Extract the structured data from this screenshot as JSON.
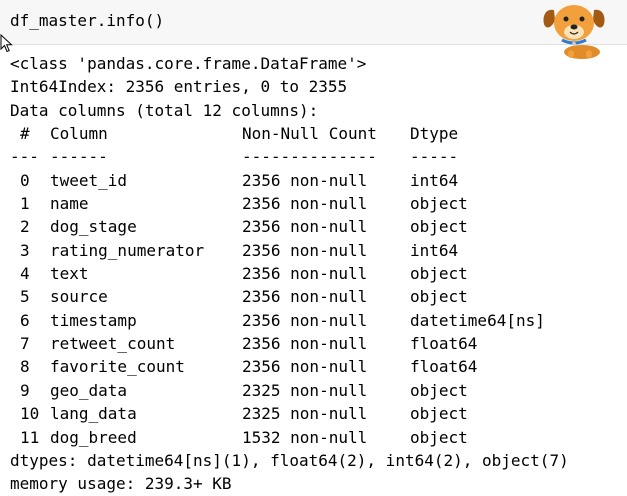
{
  "cell": {
    "code": "df_master.info()"
  },
  "output": {
    "class_line": "<class 'pandas.core.frame.DataFrame'>",
    "index_line": "Int64Index: 2356 entries, 0 to 2355",
    "columns_line": "Data columns (total 12 columns):",
    "header": {
      "idx": "#",
      "column": "Column",
      "count": "Non-Null Count",
      "dtype": "Dtype"
    },
    "separator": {
      "idx": "---",
      "column": "------",
      "count": "--------------",
      "dtype": "-----"
    },
    "rows": [
      {
        "idx": "0",
        "column": "tweet_id",
        "count": "2356 non-null",
        "dtype": "int64"
      },
      {
        "idx": "1",
        "column": "name",
        "count": "2356 non-null",
        "dtype": "object"
      },
      {
        "idx": "2",
        "column": "dog_stage",
        "count": "2356 non-null",
        "dtype": "object"
      },
      {
        "idx": "3",
        "column": "rating_numerator",
        "count": "2356 non-null",
        "dtype": "int64"
      },
      {
        "idx": "4",
        "column": "text",
        "count": "2356 non-null",
        "dtype": "object"
      },
      {
        "idx": "5",
        "column": "source",
        "count": "2356 non-null",
        "dtype": "object"
      },
      {
        "idx": "6",
        "column": "timestamp",
        "count": "2356 non-null",
        "dtype": "datetime64[ns]"
      },
      {
        "idx": "7",
        "column": "retweet_count",
        "count": "2356 non-null",
        "dtype": "float64"
      },
      {
        "idx": "8",
        "column": "favorite_count",
        "count": "2356 non-null",
        "dtype": "float64"
      },
      {
        "idx": "9",
        "column": "geo_data",
        "count": "2325 non-null",
        "dtype": "object"
      },
      {
        "idx": "10",
        "column": "lang_data",
        "count": "2325 non-null",
        "dtype": "object"
      },
      {
        "idx": "11",
        "column": "dog_breed",
        "count": "1532 non-null",
        "dtype": "object"
      }
    ],
    "dtypes_line": "dtypes: datetime64[ns](1), float64(2), int64(2), object(7)",
    "memory_line": "memory usage: 239.3+ KB"
  },
  "icons": {
    "cursor": "mouse-pointer-icon",
    "mascot": "dog-face-icon"
  }
}
